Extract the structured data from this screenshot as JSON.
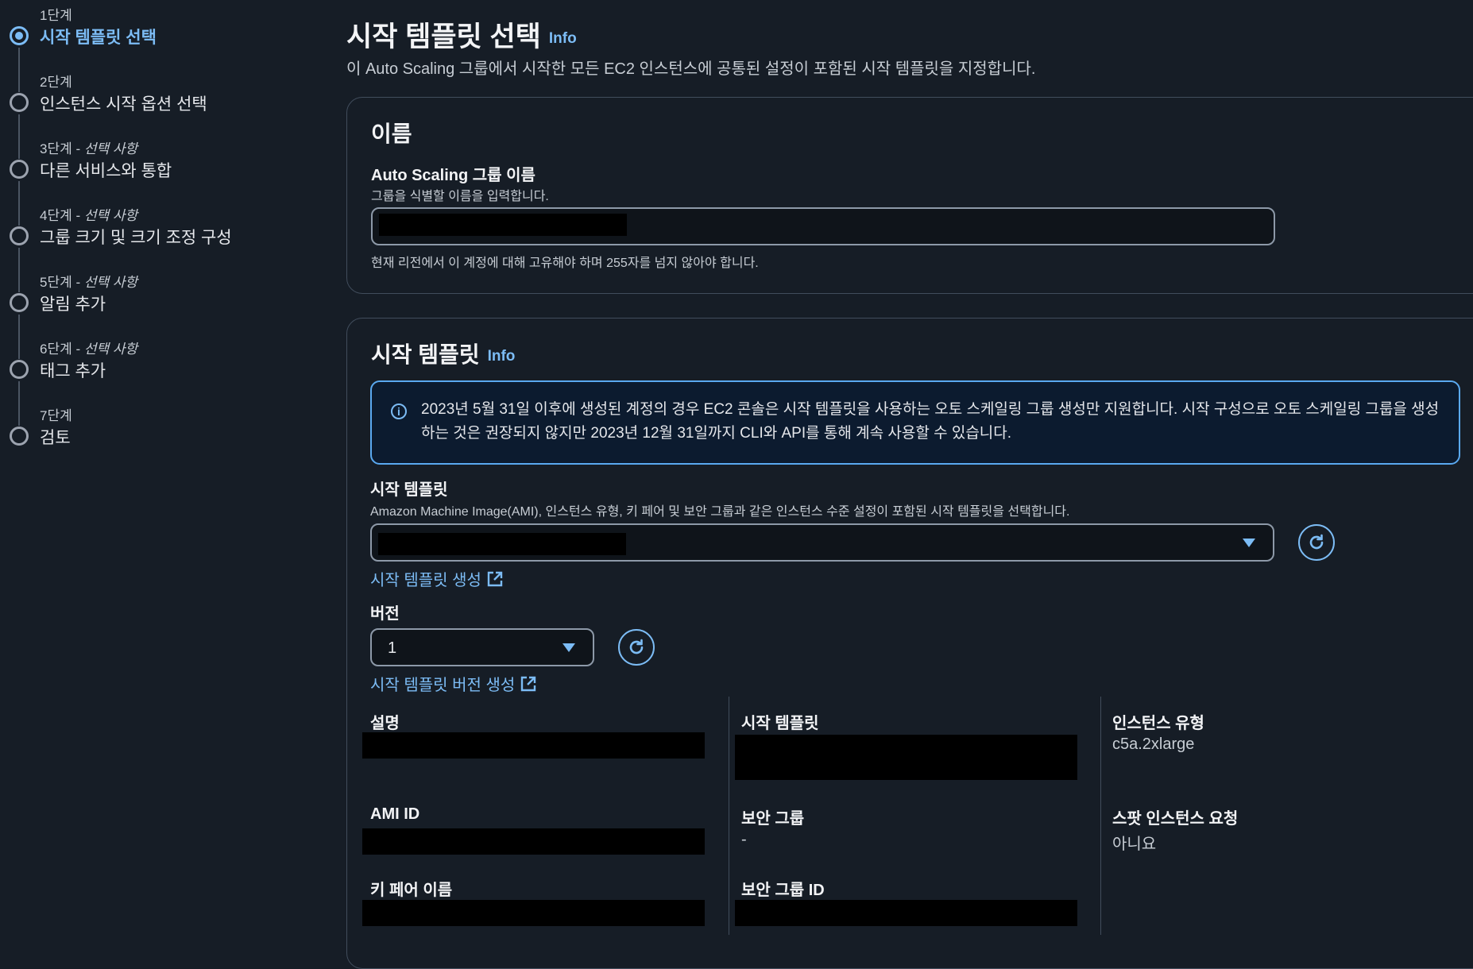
{
  "stepper": {
    "steps": [
      {
        "num": "1단계",
        "optional": "",
        "title": "시작 템플릿 선택",
        "active": true
      },
      {
        "num": "2단계",
        "optional": "",
        "title": "인스턴스 시작 옵션 선택",
        "active": false
      },
      {
        "num": "3단계 - ",
        "optional": "선택 사항",
        "title": "다른 서비스와 통합",
        "active": false
      },
      {
        "num": "4단계 - ",
        "optional": "선택 사항",
        "title": "그룹 크기 및 크기 조정 구성",
        "active": false
      },
      {
        "num": "5단계 - ",
        "optional": "선택 사항",
        "title": "알림 추가",
        "active": false
      },
      {
        "num": "6단계 - ",
        "optional": "선택 사항",
        "title": "태그 추가",
        "active": false
      },
      {
        "num": "7단계",
        "optional": "",
        "title": "검토",
        "active": false
      }
    ]
  },
  "header": {
    "title": "시작 템플릿 선택",
    "info": "Info",
    "description": "이 Auto Scaling 그룹에서 시작한 모든 EC2 인스턴스에 공통된 설정이 포함된 시작 템플릿을 지정합니다."
  },
  "name_panel": {
    "heading": "이름",
    "field_label": "Auto Scaling 그룹 이름",
    "field_desc": "그룹을 식별할 이름을 입력합니다.",
    "field_value": "",
    "constraint": "현재 리전에서 이 계정에 대해 고유해야 하며 255자를 넘지 않아야 합니다."
  },
  "template_panel": {
    "heading": "시작 템플릿",
    "info": "Info",
    "alert": "2023년 5월 31일 이후에 생성된 계정의 경우 EC2 콘솔은 시작 템플릿을 사용하는 오토 스케일링 그룹 생성만 지원합니다. 시작 구성으로 오토 스케일링 그룹을 생성하는 것은 권장되지 않지만 2023년 12월 31일까지 CLI와 API를 통해 계속 사용할 수 있습니다.",
    "template_label": "시작 템플릿",
    "template_desc": "Amazon Machine Image(AMI), 인스턴스 유형, 키 페어 및 보안 그룹과 같은 인스턴스 수준 설정이 포함된 시작 템플릿을 선택합니다.",
    "create_template_link": "시작 템플릿 생성",
    "version_label": "버전",
    "version_value": "1",
    "create_version_link": "시작 템플릿 버전 생성",
    "details": {
      "description_label": "설명",
      "template_label": "시작 템플릿",
      "instance_type_label": "인스턴스 유형",
      "instance_type_value": "c5a.2xlarge",
      "ami_label": "AMI ID",
      "security_group_label": "보안 그룹",
      "security_group_value": "-",
      "spot_label": "스팟 인스턴스 요청",
      "spot_value": "아니요",
      "key_pair_label": "키 페어 이름",
      "security_group_id_label": "보안 그룹 ID"
    }
  },
  "colors": {
    "background": "#161d26",
    "accent": "#7cbcf5",
    "alert_border": "#5aa9f0"
  }
}
